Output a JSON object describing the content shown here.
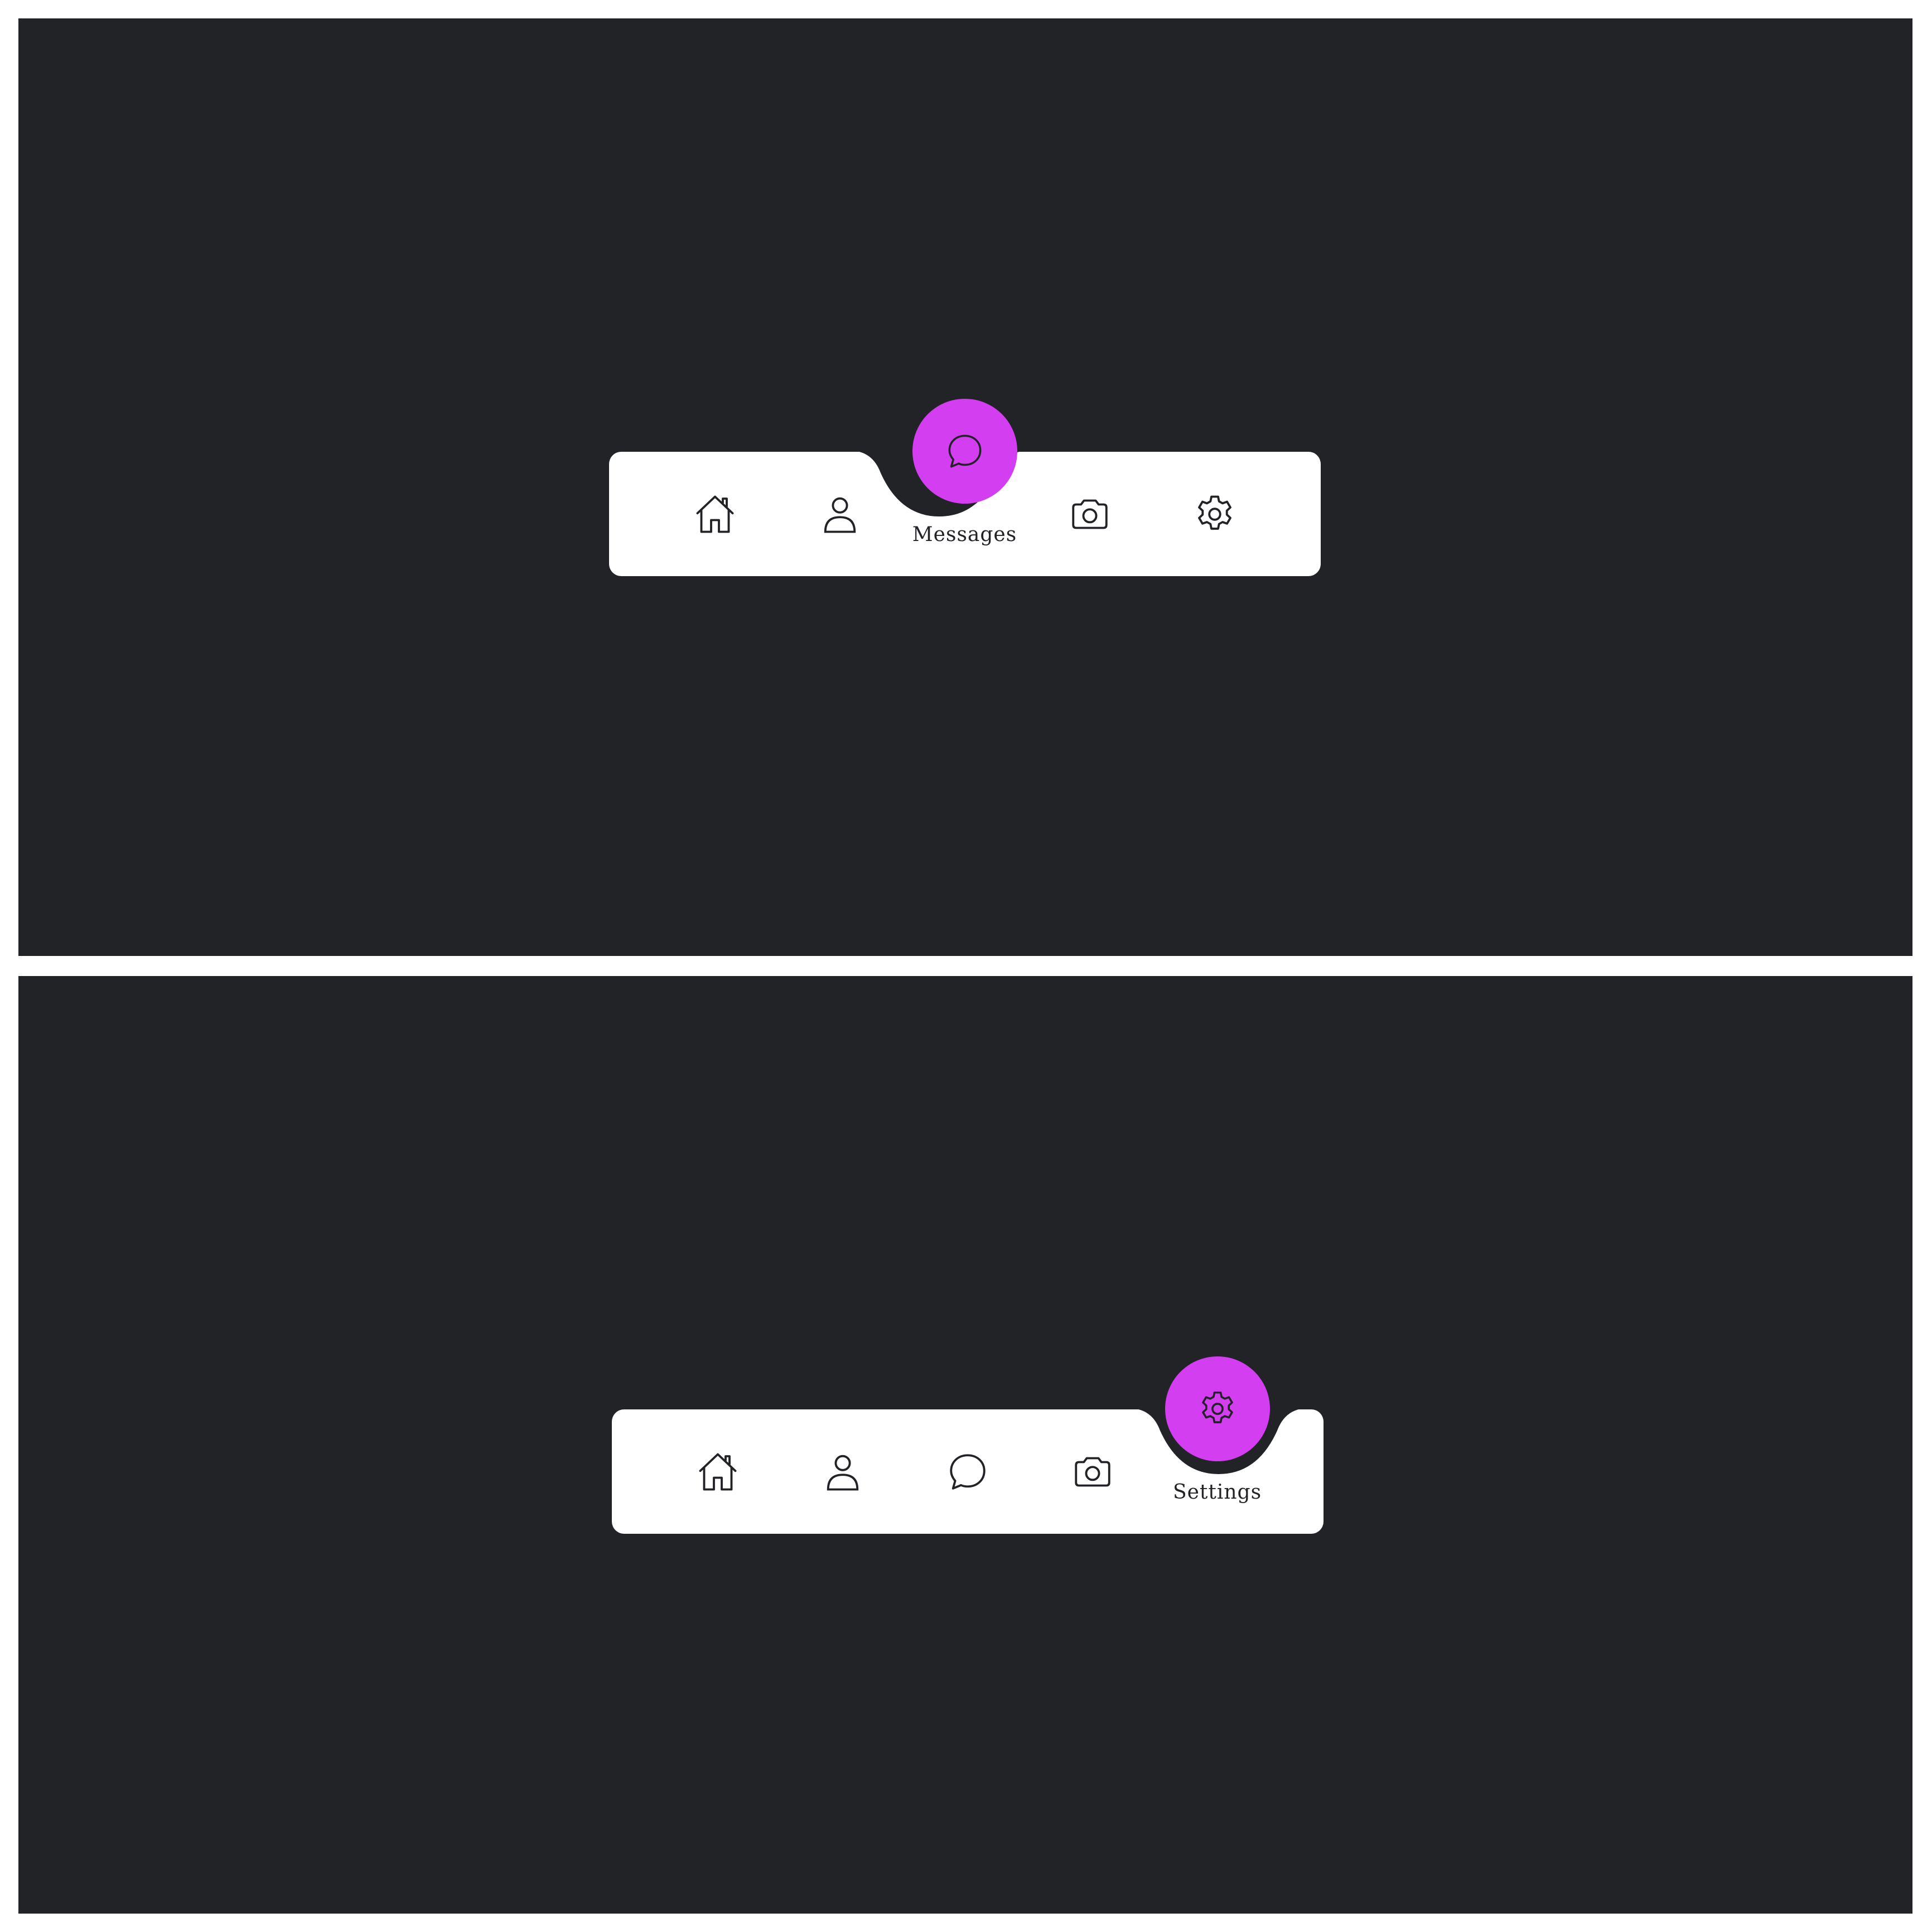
{
  "colors": {
    "background": "#222327",
    "nav_bar": "#ffffff",
    "active_indicator": "#d33ef0",
    "icon_stroke": "#222327"
  },
  "states": [
    {
      "active_index": 2,
      "active_label": "Messages",
      "items": [
        {
          "icon": "home-icon"
        },
        {
          "icon": "user-icon"
        },
        {
          "icon": "chat-icon"
        },
        {
          "icon": "camera-icon"
        },
        {
          "icon": "gear-icon"
        }
      ]
    },
    {
      "active_index": 4,
      "active_label": "Settings",
      "items": [
        {
          "icon": "home-icon"
        },
        {
          "icon": "user-icon"
        },
        {
          "icon": "chat-icon"
        },
        {
          "icon": "camera-icon"
        },
        {
          "icon": "gear-icon"
        }
      ]
    }
  ]
}
